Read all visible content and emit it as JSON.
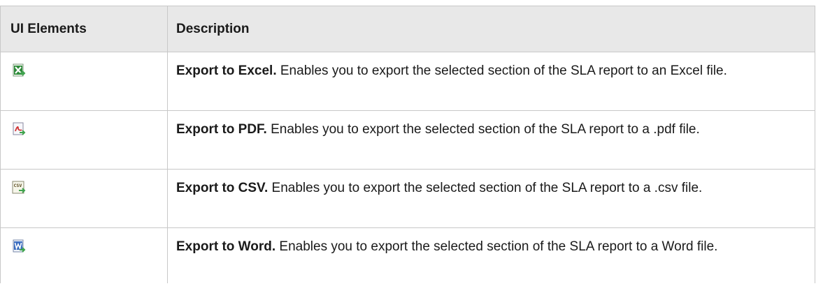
{
  "table": {
    "headers": {
      "elements": "UI Elements",
      "description": "Description"
    },
    "rows": [
      {
        "icon": "export-to-excel-icon",
        "title": "Export to Excel.",
        "text": " Enables you to export the selected section of the SLA report to an Excel file."
      },
      {
        "icon": "export-to-pdf-icon",
        "title": "Export to PDF.",
        "text": " Enables you to export the selected section of the SLA report to a .pdf file."
      },
      {
        "icon": "export-to-csv-icon",
        "title": "Export to CSV.",
        "text": " Enables you to export the selected section of the SLA report to a .csv file."
      },
      {
        "icon": "export-to-word-icon",
        "title": "Export to Word.",
        "text": " Enables you to export the selected section of the SLA report to a Word file."
      }
    ],
    "icon_label": "CSV"
  },
  "colors": {
    "header_bg": "#e8e8e8",
    "border": "#c8c8c8",
    "excel_green": "#2e8b3a",
    "pdf_red": "#d03030",
    "word_blue": "#3a6cc0",
    "arrow_green": "#3fa34d"
  }
}
